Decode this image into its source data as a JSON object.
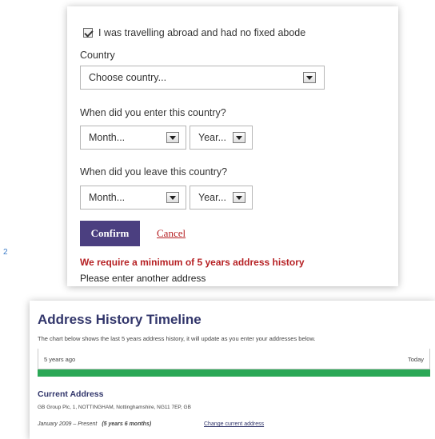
{
  "form": {
    "abroad_checkbox_label": "I was travelling abroad and had no fixed abode",
    "abroad_checked": true,
    "country_label": "Country",
    "country_select_value": "Choose country...",
    "enter_label": "When did you enter this country?",
    "enter_month_value": "Month...",
    "enter_year_value": "Year...",
    "leave_label": "When did you leave this country?",
    "leave_month_value": "Month...",
    "leave_year_value": "Year...",
    "confirm_label": "Confirm",
    "cancel_label": "Cancel",
    "error_text": "We require a minimum of 5 years address history",
    "note_text": "Please enter another address"
  },
  "side_mark": "2",
  "timeline": {
    "title": "Address History Timeline",
    "description": "The chart below shows the last 5 years address history, it will update as you enter your addresses below.",
    "start_label": "5 years ago",
    "end_label": "Today",
    "fill_fraction": 1.0,
    "bar_color": "#2ba856"
  },
  "current_address": {
    "heading": "Current Address",
    "address": "GB Group Plc, 1, NOTTINGHAM, Nottinghamshire, NG11 7EP, GB",
    "period": "January 2009 – Present",
    "duration": "(5 years 6 months)",
    "change_link": "Change current address"
  },
  "colors": {
    "primary_button": "#4b3f80",
    "error": "#b62124",
    "heading": "#32366b"
  }
}
